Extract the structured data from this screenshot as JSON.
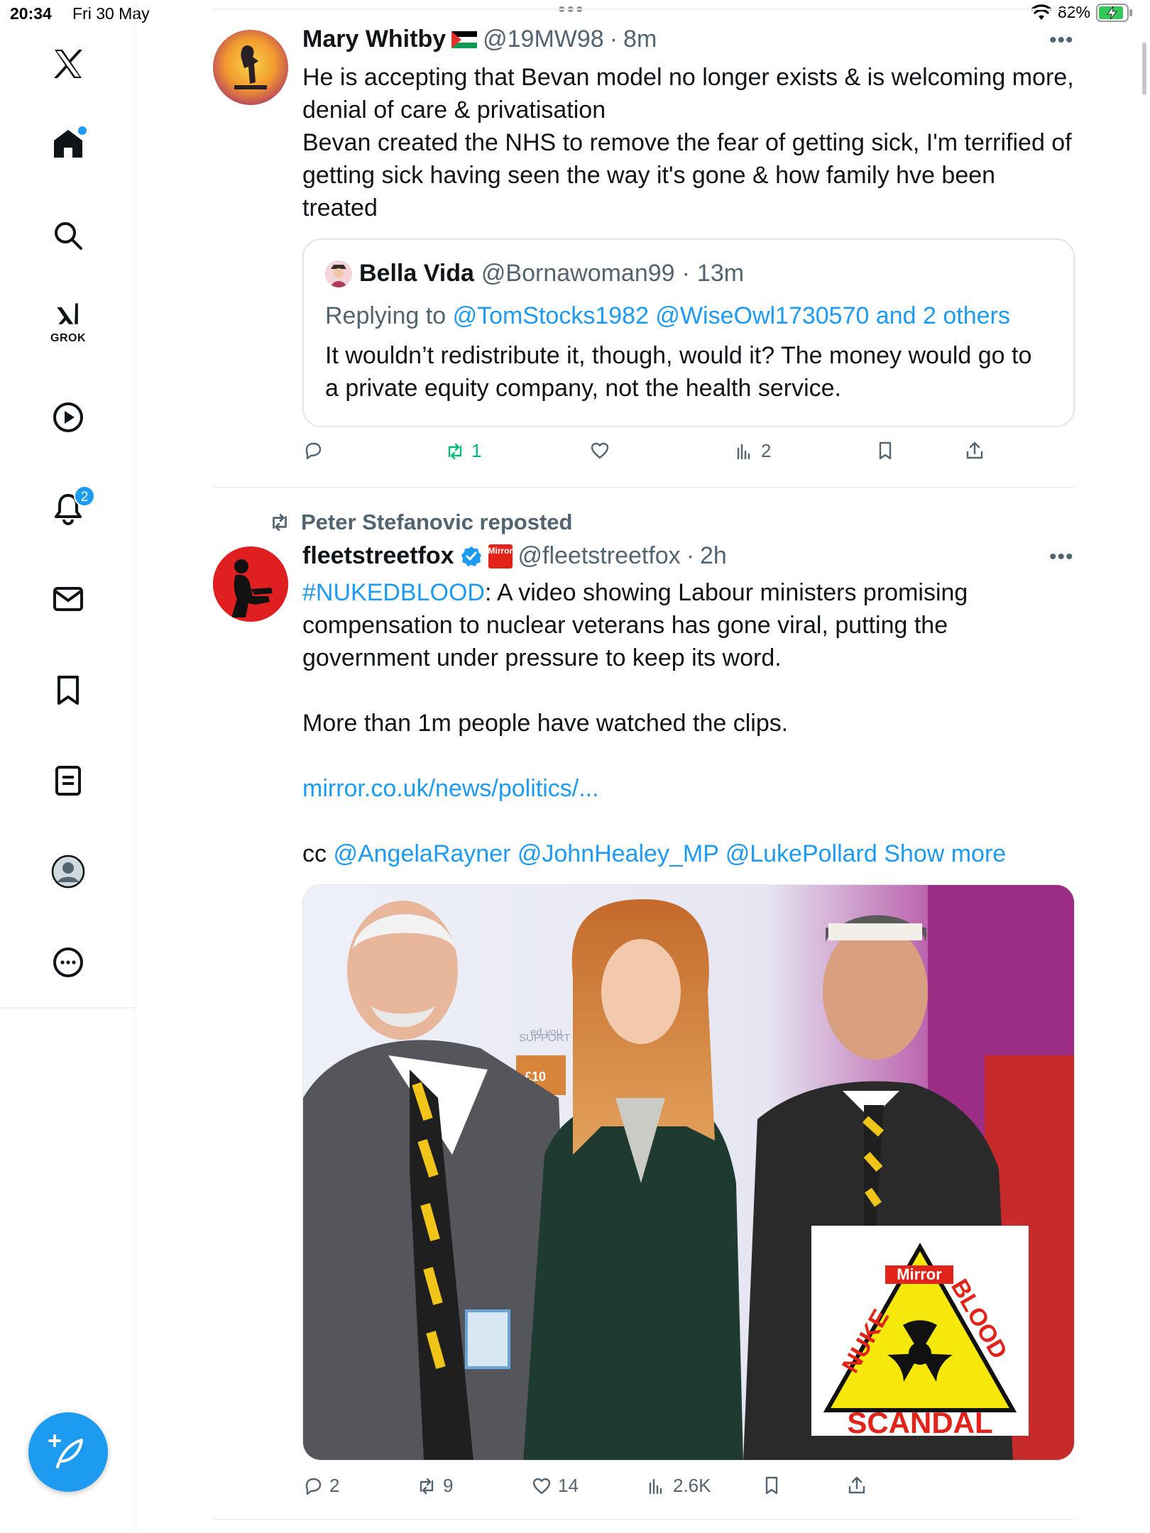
{
  "status_bar": {
    "time": "20:34",
    "date": "Fri 30 May",
    "battery": "82%"
  },
  "sidebar": {
    "grok_label": "GROK",
    "notifications_badge": "2"
  },
  "tweet1": {
    "author": "Mary Whitby",
    "handle": "@19MW98",
    "time": "8m",
    "text_lines": [
      "He is accepting that Bevan model no longer exists & is welcoming more,",
      "denial of care & privatisation",
      "Bevan created the NHS to remove the fear of getting sick, I'm terrified of",
      "getting sick having seen the way it's gone & how family hve been",
      "treated"
    ],
    "quote": {
      "author": "Bella Vida",
      "handle": "@Bornawoman99",
      "time": "13m",
      "replying_prefix": "Replying to",
      "replying_to": "@TomStocks1982 @WiseOwl1730570 and 2 others",
      "text_lines": [
        "It wouldn’t redistribute it, though, would it? The money would go to",
        "a private equity company, not the health service."
      ]
    },
    "actions": {
      "replies": "",
      "reposts": "1",
      "likes": "",
      "views": "2"
    }
  },
  "tweet2": {
    "reposted_by": "Peter Stefanovic reposted",
    "author": "fleetstreetfox",
    "affiliate_badge": "Mirror",
    "handle": "@fleetstreetfox",
    "time": "2h",
    "hashtag": "#NUKEDBLOOD",
    "text_lines": [
      ": A video showing Labour ministers promising",
      "compensation to nuclear veterans has gone viral, putting the",
      "government under pressure to keep its word."
    ],
    "text2": "More than 1m people have watched the clips.",
    "link": "mirror.co.uk/news/politics/...",
    "cc_prefix": "cc",
    "cc_mentions": "@AngelaRayner @JohnHealey_MP @LukePollard",
    "show_more": "Show more",
    "image_logo": {
      "brand": "Mirror",
      "left": "NUKE",
      "right": "BLOOD",
      "bottom": "SCANDAL"
    },
    "image_bg_text": {
      "support": "SUPPORT THE CASE",
      "amount": "£10",
      "signed": "ed you"
    },
    "actions": {
      "replies": "2",
      "reposts": "9",
      "likes": "14",
      "views": "2.6K"
    }
  },
  "colors": {
    "accent": "#1d9bf0",
    "repost_green": "#00ba7c",
    "muted": "#536471"
  }
}
